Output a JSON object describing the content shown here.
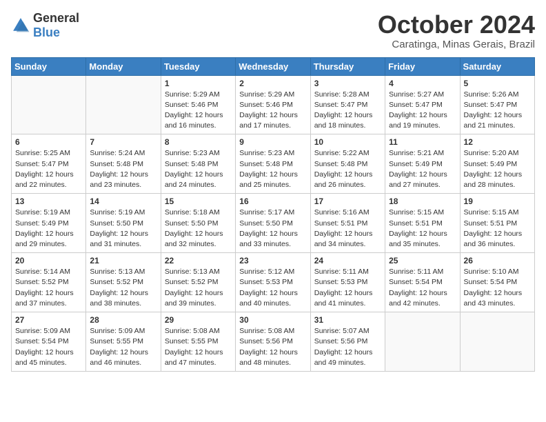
{
  "header": {
    "logo_general": "General",
    "logo_blue": "Blue",
    "month_year": "October 2024",
    "location": "Caratinga, Minas Gerais, Brazil"
  },
  "weekdays": [
    "Sunday",
    "Monday",
    "Tuesday",
    "Wednesday",
    "Thursday",
    "Friday",
    "Saturday"
  ],
  "weeks": [
    [
      {
        "day": "",
        "sunrise": "",
        "sunset": "",
        "daylight": ""
      },
      {
        "day": "",
        "sunrise": "",
        "sunset": "",
        "daylight": ""
      },
      {
        "day": "1",
        "sunrise": "Sunrise: 5:29 AM",
        "sunset": "Sunset: 5:46 PM",
        "daylight": "Daylight: 12 hours and 16 minutes."
      },
      {
        "day": "2",
        "sunrise": "Sunrise: 5:29 AM",
        "sunset": "Sunset: 5:46 PM",
        "daylight": "Daylight: 12 hours and 17 minutes."
      },
      {
        "day": "3",
        "sunrise": "Sunrise: 5:28 AM",
        "sunset": "Sunset: 5:47 PM",
        "daylight": "Daylight: 12 hours and 18 minutes."
      },
      {
        "day": "4",
        "sunrise": "Sunrise: 5:27 AM",
        "sunset": "Sunset: 5:47 PM",
        "daylight": "Daylight: 12 hours and 19 minutes."
      },
      {
        "day": "5",
        "sunrise": "Sunrise: 5:26 AM",
        "sunset": "Sunset: 5:47 PM",
        "daylight": "Daylight: 12 hours and 21 minutes."
      }
    ],
    [
      {
        "day": "6",
        "sunrise": "Sunrise: 5:25 AM",
        "sunset": "Sunset: 5:47 PM",
        "daylight": "Daylight: 12 hours and 22 minutes."
      },
      {
        "day": "7",
        "sunrise": "Sunrise: 5:24 AM",
        "sunset": "Sunset: 5:48 PM",
        "daylight": "Daylight: 12 hours and 23 minutes."
      },
      {
        "day": "8",
        "sunrise": "Sunrise: 5:23 AM",
        "sunset": "Sunset: 5:48 PM",
        "daylight": "Daylight: 12 hours and 24 minutes."
      },
      {
        "day": "9",
        "sunrise": "Sunrise: 5:23 AM",
        "sunset": "Sunset: 5:48 PM",
        "daylight": "Daylight: 12 hours and 25 minutes."
      },
      {
        "day": "10",
        "sunrise": "Sunrise: 5:22 AM",
        "sunset": "Sunset: 5:48 PM",
        "daylight": "Daylight: 12 hours and 26 minutes."
      },
      {
        "day": "11",
        "sunrise": "Sunrise: 5:21 AM",
        "sunset": "Sunset: 5:49 PM",
        "daylight": "Daylight: 12 hours and 27 minutes."
      },
      {
        "day": "12",
        "sunrise": "Sunrise: 5:20 AM",
        "sunset": "Sunset: 5:49 PM",
        "daylight": "Daylight: 12 hours and 28 minutes."
      }
    ],
    [
      {
        "day": "13",
        "sunrise": "Sunrise: 5:19 AM",
        "sunset": "Sunset: 5:49 PM",
        "daylight": "Daylight: 12 hours and 29 minutes."
      },
      {
        "day": "14",
        "sunrise": "Sunrise: 5:19 AM",
        "sunset": "Sunset: 5:50 PM",
        "daylight": "Daylight: 12 hours and 31 minutes."
      },
      {
        "day": "15",
        "sunrise": "Sunrise: 5:18 AM",
        "sunset": "Sunset: 5:50 PM",
        "daylight": "Daylight: 12 hours and 32 minutes."
      },
      {
        "day": "16",
        "sunrise": "Sunrise: 5:17 AM",
        "sunset": "Sunset: 5:50 PM",
        "daylight": "Daylight: 12 hours and 33 minutes."
      },
      {
        "day": "17",
        "sunrise": "Sunrise: 5:16 AM",
        "sunset": "Sunset: 5:51 PM",
        "daylight": "Daylight: 12 hours and 34 minutes."
      },
      {
        "day": "18",
        "sunrise": "Sunrise: 5:15 AM",
        "sunset": "Sunset: 5:51 PM",
        "daylight": "Daylight: 12 hours and 35 minutes."
      },
      {
        "day": "19",
        "sunrise": "Sunrise: 5:15 AM",
        "sunset": "Sunset: 5:51 PM",
        "daylight": "Daylight: 12 hours and 36 minutes."
      }
    ],
    [
      {
        "day": "20",
        "sunrise": "Sunrise: 5:14 AM",
        "sunset": "Sunset: 5:52 PM",
        "daylight": "Daylight: 12 hours and 37 minutes."
      },
      {
        "day": "21",
        "sunrise": "Sunrise: 5:13 AM",
        "sunset": "Sunset: 5:52 PM",
        "daylight": "Daylight: 12 hours and 38 minutes."
      },
      {
        "day": "22",
        "sunrise": "Sunrise: 5:13 AM",
        "sunset": "Sunset: 5:52 PM",
        "daylight": "Daylight: 12 hours and 39 minutes."
      },
      {
        "day": "23",
        "sunrise": "Sunrise: 5:12 AM",
        "sunset": "Sunset: 5:53 PM",
        "daylight": "Daylight: 12 hours and 40 minutes."
      },
      {
        "day": "24",
        "sunrise": "Sunrise: 5:11 AM",
        "sunset": "Sunset: 5:53 PM",
        "daylight": "Daylight: 12 hours and 41 minutes."
      },
      {
        "day": "25",
        "sunrise": "Sunrise: 5:11 AM",
        "sunset": "Sunset: 5:54 PM",
        "daylight": "Daylight: 12 hours and 42 minutes."
      },
      {
        "day": "26",
        "sunrise": "Sunrise: 5:10 AM",
        "sunset": "Sunset: 5:54 PM",
        "daylight": "Daylight: 12 hours and 43 minutes."
      }
    ],
    [
      {
        "day": "27",
        "sunrise": "Sunrise: 5:09 AM",
        "sunset": "Sunset: 5:54 PM",
        "daylight": "Daylight: 12 hours and 45 minutes."
      },
      {
        "day": "28",
        "sunrise": "Sunrise: 5:09 AM",
        "sunset": "Sunset: 5:55 PM",
        "daylight": "Daylight: 12 hours and 46 minutes."
      },
      {
        "day": "29",
        "sunrise": "Sunrise: 5:08 AM",
        "sunset": "Sunset: 5:55 PM",
        "daylight": "Daylight: 12 hours and 47 minutes."
      },
      {
        "day": "30",
        "sunrise": "Sunrise: 5:08 AM",
        "sunset": "Sunset: 5:56 PM",
        "daylight": "Daylight: 12 hours and 48 minutes."
      },
      {
        "day": "31",
        "sunrise": "Sunrise: 5:07 AM",
        "sunset": "Sunset: 5:56 PM",
        "daylight": "Daylight: 12 hours and 49 minutes."
      },
      {
        "day": "",
        "sunrise": "",
        "sunset": "",
        "daylight": ""
      },
      {
        "day": "",
        "sunrise": "",
        "sunset": "",
        "daylight": ""
      }
    ]
  ]
}
